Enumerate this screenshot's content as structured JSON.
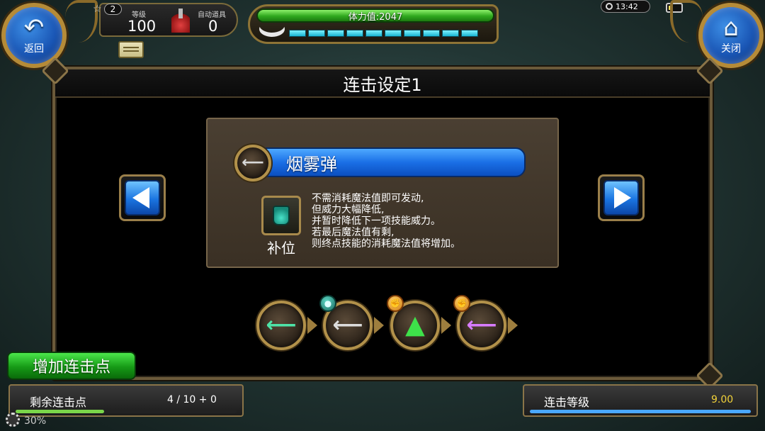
{
  "hud": {
    "back_label": "返回",
    "close_label": "关闭",
    "rank": "2",
    "level_label": "等级",
    "level_value": "100",
    "auto_item_label": "自动道具",
    "auto_item_value": "0",
    "stamina_text": "体力值:2047",
    "stamina_segments": 10,
    "time": "13:42"
  },
  "panel": {
    "title": "连击设定1",
    "skill_name": "烟雾弹",
    "position_label": "补位",
    "description": [
      "不需消耗魔法值即可发动,",
      "但威力大幅降低,",
      "并暂时降低下一项技能威力。",
      "若最后魔法值有剩,",
      "则终点技能的消耗魔法值将增加。"
    ],
    "chain": [
      {
        "icon": "green-arrow-icon",
        "badge": null
      },
      {
        "icon": "white-arrow-icon",
        "badge": "bottle-badge-icon"
      },
      {
        "icon": "green-up-arrow-icon",
        "badge": "fist-badge-icon"
      },
      {
        "icon": "purple-arrow-icon",
        "badge": "fist-badge-icon"
      }
    ]
  },
  "bottom": {
    "add_combo_label": "增加连击点",
    "remaining_label": "剩余连击点",
    "remaining_value": "4 / 10 + 0",
    "remaining_progress": 0.4,
    "combo_level_label": "连击等级",
    "combo_level_value": "9.00",
    "combo_level_progress": 1.0,
    "partial_text": "30%"
  },
  "colors": {
    "stamina": "#2fa81e",
    "skill_bar": "#1a6fe6",
    "add_button": "#169a16",
    "level_value": "#f2d23a"
  }
}
